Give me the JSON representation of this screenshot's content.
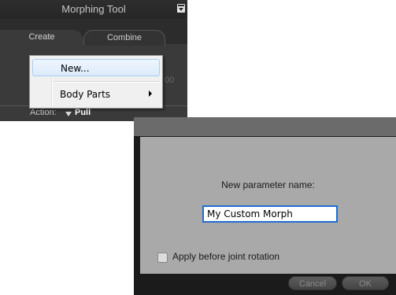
{
  "panel": {
    "title": "Morphing Tool",
    "tabs": [
      {
        "label": "Create"
      },
      {
        "label": "Combine"
      }
    ],
    "partial_value": "00",
    "action_label": "Action:",
    "action_value": "Pull"
  },
  "context_menu": {
    "items": [
      {
        "label": "New..."
      },
      {
        "label": "Body Parts"
      }
    ]
  },
  "dialog": {
    "prompt": "New parameter name:",
    "input_value": "My Custom Morph",
    "checkbox_label": "Apply before joint rotation",
    "cancel_label": "Cancel",
    "ok_label": "OK"
  }
}
